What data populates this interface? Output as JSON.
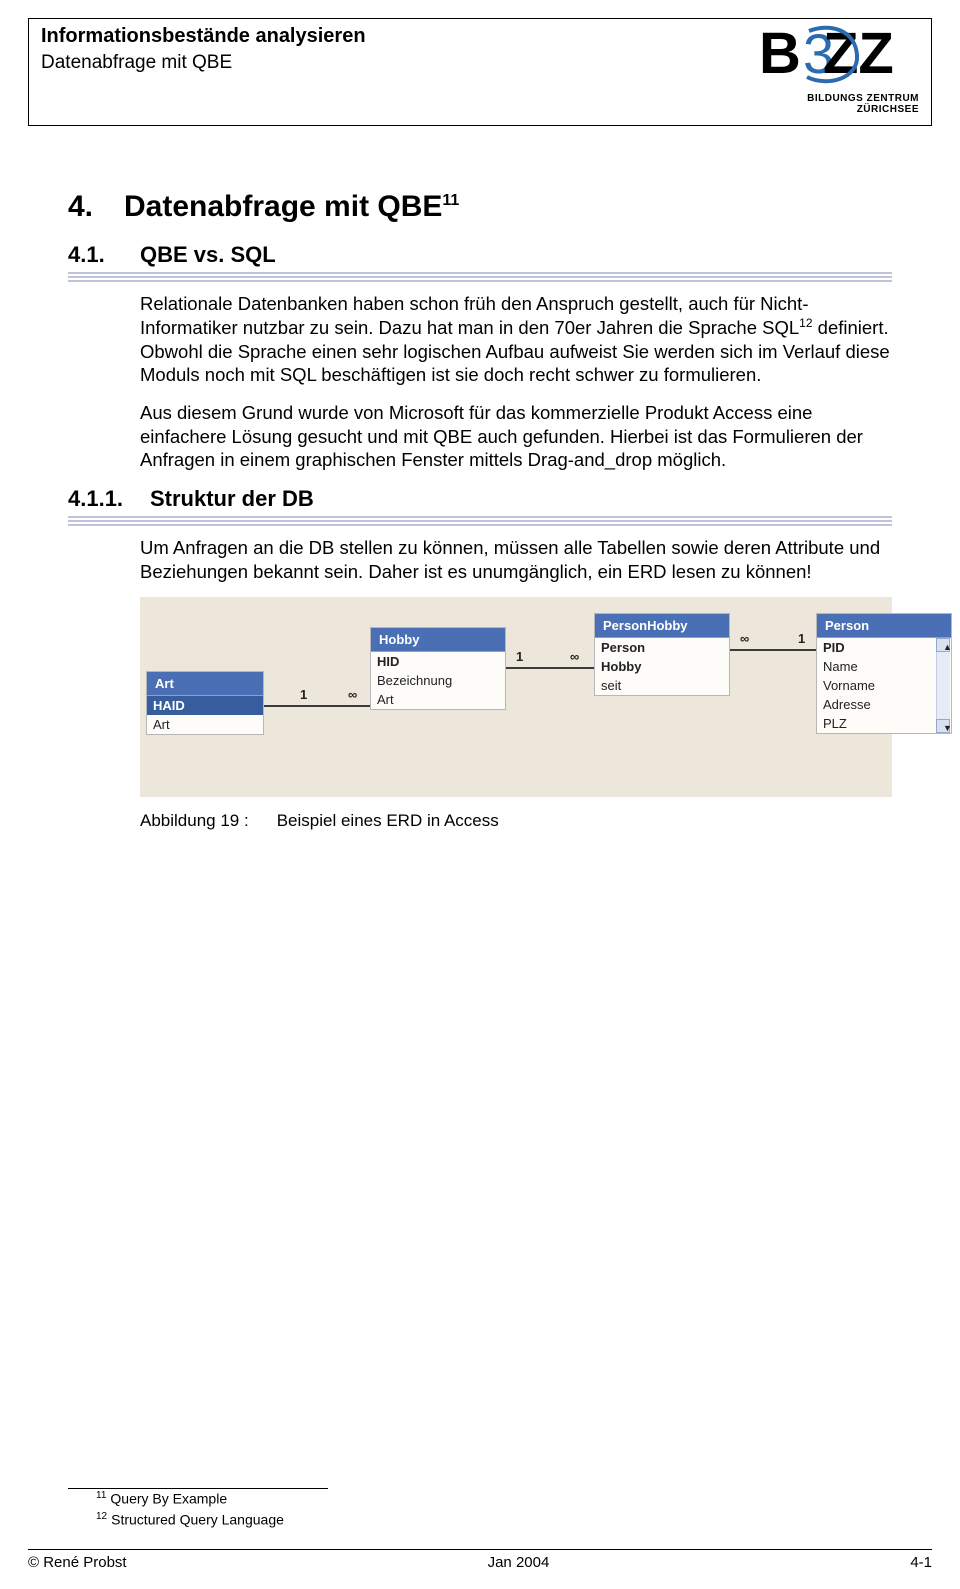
{
  "header": {
    "title": "Informationsbestände analysieren",
    "subtitle": "Datenabfrage mit QBE",
    "logo_caption": "BILDUNGS ZENTRUM ZÜRICHSEE"
  },
  "h1": {
    "num": "4.",
    "text": "Datenabfrage mit QBE",
    "sup": "11"
  },
  "h2a": {
    "num": "4.1.",
    "text": "QBE vs. SQL"
  },
  "para1": "Relationale Datenbanken haben schon früh den Anspruch gestellt, auch für Nicht-Informatiker nutzbar zu sein. Dazu hat man in den 70er Jahren die Sprache SQL",
  "para1_sup": "12",
  "para1_cont": " definiert. Obwohl die Sprache einen sehr logischen Aufbau aufweist Sie werden sich im Verlauf diese Moduls noch mit SQL beschäftigen ist sie doch recht schwer zu formulieren.",
  "para2": "Aus diesem Grund wurde von Microsoft für das kommerzielle Produkt Access eine einfachere Lösung gesucht und mit QBE auch gefunden. Hierbei ist das Formulieren der Anfragen in einem graphischen Fenster mittels Drag-and_drop möglich.",
  "h2b": {
    "num": "4.1.1.",
    "text": "Struktur der DB"
  },
  "para3": "Um Anfragen an die DB stellen zu können, müssen alle Tabellen sowie deren Attribute und Beziehungen bekannt sein. Daher ist es unumgänglich, ein ERD lesen zu können!",
  "erd": {
    "tables": [
      {
        "name": "Art",
        "fields": [
          "HAID",
          "Art"
        ],
        "pk_highlight": true
      },
      {
        "name": "Hobby",
        "fields": [
          "HID",
          "Bezeichnung",
          "Art"
        ]
      },
      {
        "name": "PersonHobby",
        "fields": [
          "Person",
          "Hobby",
          "seit"
        ]
      },
      {
        "name": "Person",
        "fields": [
          "PID",
          "Name",
          "Vorname",
          "Adresse",
          "PLZ"
        ],
        "scroll": true
      }
    ],
    "relations": [
      {
        "left": "1",
        "right": "∞"
      },
      {
        "left": "1",
        "right": "∞"
      },
      {
        "left": "∞",
        "right": "1"
      }
    ]
  },
  "caption": {
    "label": "Abbildung 19 :",
    "text": "Beispiel eines ERD in Access"
  },
  "footnotes": [
    {
      "num": "11",
      "text": "Query By Example"
    },
    {
      "num": "12",
      "text": "Structured Query Language"
    }
  ],
  "footer": {
    "left": "© René Probst",
    "center": "Jan 2004",
    "right": "4-1"
  }
}
